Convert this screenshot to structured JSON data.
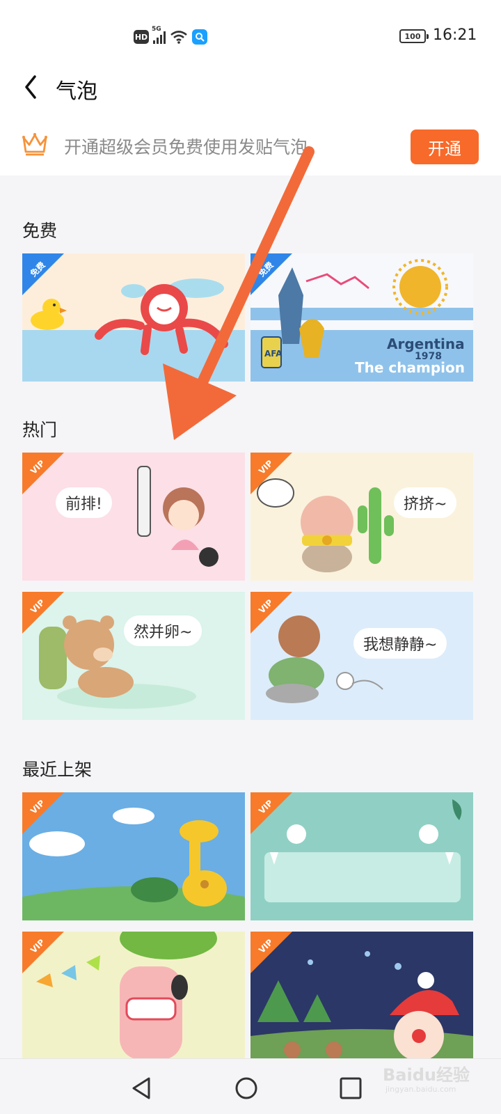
{
  "status_bar": {
    "hd": "HD",
    "network": "5G",
    "battery": "100",
    "time": "16:21"
  },
  "header": {
    "title": "气泡"
  },
  "vip_banner": {
    "text": "开通超级会员免费使用发贴气泡",
    "button": "开通"
  },
  "sections": [
    {
      "title": "免费",
      "cards": [
        {
          "tag": "免费"
        },
        {
          "tag": "免费",
          "texts": [
            "Argentina",
            "1978",
            "The champion"
          ]
        }
      ]
    },
    {
      "title": "热门",
      "cards": [
        {
          "tag": "VIP",
          "bubble": "前排!"
        },
        {
          "tag": "VIP",
          "bubble": "挤挤~"
        },
        {
          "tag": "VIP",
          "bubble": "然并卵~"
        },
        {
          "tag": "VIP",
          "bubble": "我想静静~"
        }
      ]
    },
    {
      "title": "最近上架",
      "cards": [
        {
          "tag": "VIP"
        },
        {
          "tag": "VIP"
        },
        {
          "tag": "VIP"
        },
        {
          "tag": "VIP"
        }
      ]
    }
  ],
  "watermark": {
    "main": "Baidu经验",
    "sub": "jingyan.baidu.com"
  },
  "colors": {
    "accent": "#f76a2a",
    "free_tag": "#2f86e8",
    "vip_tag": "#f77b2a",
    "background": "#f5f5f7"
  }
}
